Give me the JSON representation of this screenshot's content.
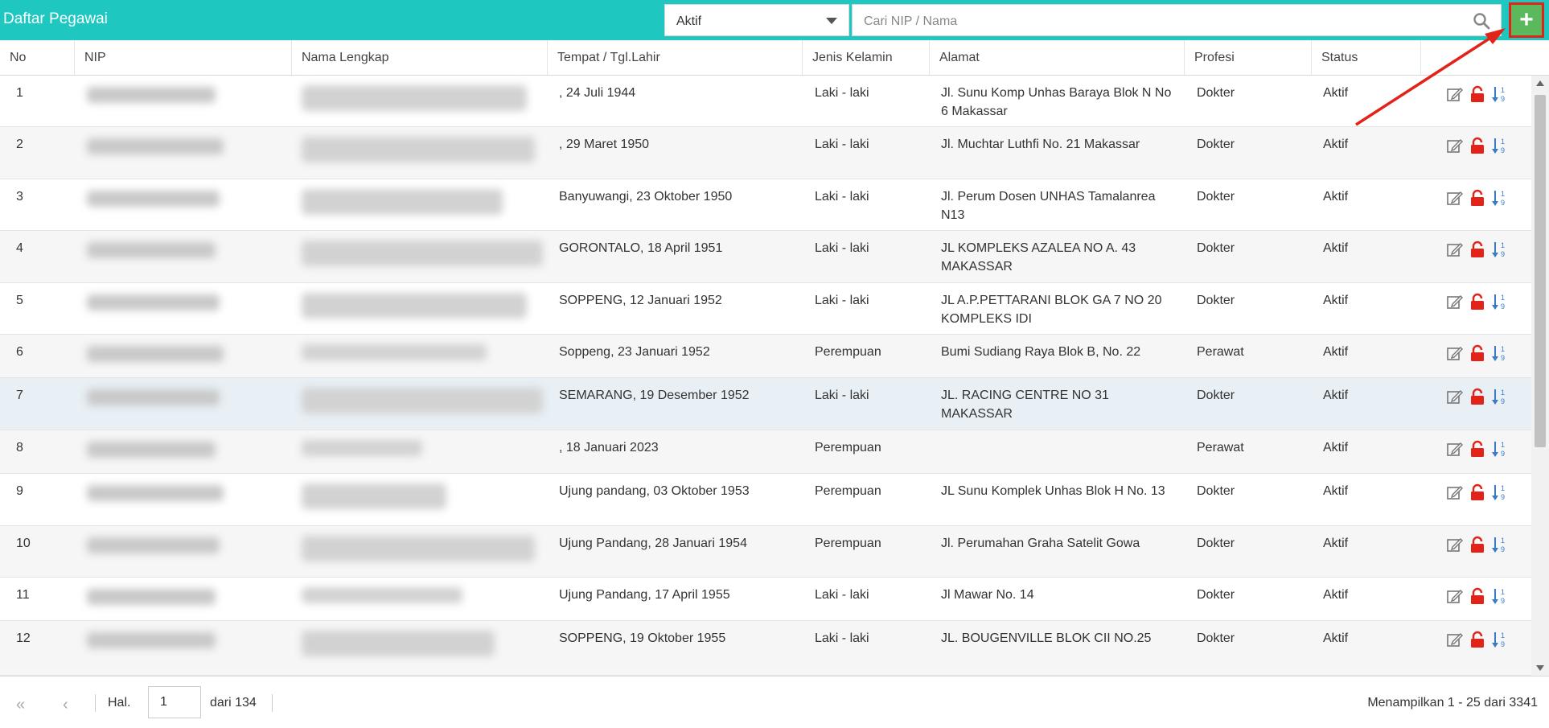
{
  "header": {
    "title": "Daftar Pegawai",
    "status_value": "Aktif",
    "search_placeholder": "Cari NIP / Nama",
    "add_label": "+"
  },
  "columns": [
    "No",
    "NIP",
    "Nama Lengkap",
    "Tempat / Tgl.Lahir",
    "Jenis Kelamin",
    "Alamat",
    "Profesi",
    "Status"
  ],
  "rows": [
    {
      "no": "1",
      "ttl": ", 24 Juli 1944",
      "jk": "Laki - laki",
      "alamat": "Jl. Sunu Komp Unhas Baraya Blok N No 6 Makassar",
      "profesi": "Dokter",
      "status": "Aktif"
    },
    {
      "no": "2",
      "ttl": ", 29 Maret 1950",
      "jk": "Laki - laki",
      "alamat": "Jl. Muchtar Luthfi No. 21 Makassar",
      "profesi": "Dokter",
      "status": "Aktif"
    },
    {
      "no": "3",
      "ttl": "Banyuwangi, 23 Oktober 1950",
      "jk": "Laki - laki",
      "alamat": "Jl. Perum Dosen UNHAS Tamalanrea N13",
      "profesi": "Dokter",
      "status": "Aktif"
    },
    {
      "no": "4",
      "ttl": "GORONTALO, 18 April 1951",
      "jk": "Laki - laki",
      "alamat": "JL KOMPLEKS AZALEA NO A. 43 MAKASSAR",
      "profesi": "Dokter",
      "status": "Aktif"
    },
    {
      "no": "5",
      "ttl": "SOPPENG, 12 Januari 1952",
      "jk": "Laki - laki",
      "alamat": "JL A.P.PETTARANI BLOK GA 7 NO 20 KOMPLEKS IDI",
      "profesi": "Dokter",
      "status": "Aktif"
    },
    {
      "no": "6",
      "ttl": "Soppeng, 23 Januari 1952",
      "jk": "Perempuan",
      "alamat": "Bumi Sudiang Raya Blok B, No. 22",
      "profesi": "Perawat",
      "status": "Aktif"
    },
    {
      "no": "7",
      "ttl": "SEMARANG, 19 Desember 1952",
      "jk": "Laki - laki",
      "alamat": "JL. RACING CENTRE NO 31 MAKASSAR",
      "profesi": "Dokter",
      "status": "Aktif"
    },
    {
      "no": "8",
      "ttl": ", 18 Januari 2023",
      "jk": "Perempuan",
      "alamat": "",
      "profesi": "Perawat",
      "status": "Aktif"
    },
    {
      "no": "9",
      "ttl": "Ujung pandang, 03 Oktober 1953",
      "jk": "Perempuan",
      "alamat": "JL Sunu Komplek Unhas Blok H No. 13",
      "profesi": "Dokter",
      "status": "Aktif"
    },
    {
      "no": "10",
      "ttl": "Ujung Pandang, 28 Januari 1954",
      "jk": "Perempuan",
      "alamat": "Jl. Perumahan Graha Satelit Gowa",
      "profesi": "Dokter",
      "status": "Aktif"
    },
    {
      "no": "11",
      "ttl": "Ujung Pandang, 17 April 1955",
      "jk": "Laki - laki",
      "alamat": "Jl Mawar No. 14",
      "profesi": "Dokter",
      "status": "Aktif"
    },
    {
      "no": "12",
      "ttl": "SOPPENG, 19 Oktober 1955",
      "jk": "Laki - laki",
      "alamat": "JL. BOUGENVILLE BLOK CII NO.25",
      "profesi": "Dokter",
      "status": "Aktif"
    }
  ],
  "pagination": {
    "page_label": "Hal.",
    "page_value": "1",
    "of_label": "dari 134",
    "summary": "Menampilkan 1 - 25 dari 3341"
  },
  "colors": {
    "header_bg": "#1ec7c0",
    "add_button": "#5cb85c",
    "highlight": "#e2231a",
    "edit_icon": "#777777",
    "lock_icon": "#e2231a",
    "order_icon": "#3a7bc8"
  },
  "icons": [
    "search-icon",
    "add-icon",
    "edit-icon",
    "lock-icon",
    "sort-order-icon",
    "first-page-icon",
    "prev-page-icon"
  ]
}
